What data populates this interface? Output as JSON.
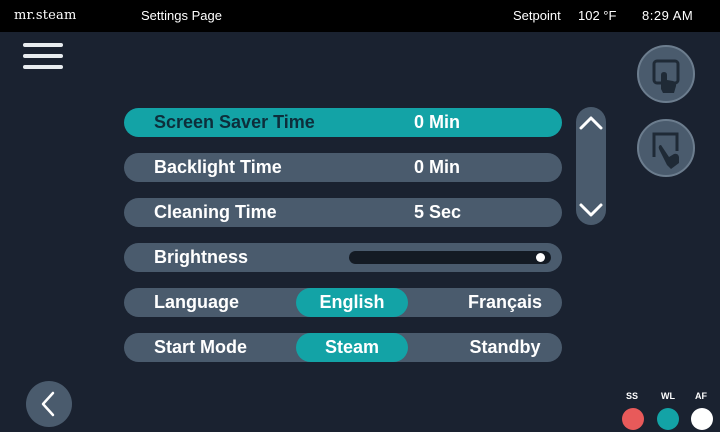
{
  "header": {
    "brand": "mr.steam",
    "title": "Settings Page",
    "setpoint_label": "Setpoint",
    "setpoint_value": "102 °F",
    "time": "8:29 AM"
  },
  "icons": {
    "menu": "hamburger-menu-icon",
    "touch_top": "hand-touch-up-icon",
    "touch_bottom": "hand-touch-down-icon",
    "scroll_up": "chevron-up-icon",
    "scroll_down": "chevron-down-icon",
    "back": "chevron-left-icon"
  },
  "settings": {
    "screen_saver": {
      "label": "Screen Saver Time",
      "value": "0 Min",
      "selected": true
    },
    "backlight": {
      "label": "Backlight Time",
      "value": "0 Min"
    },
    "cleaning": {
      "label": "Cleaning Time",
      "value": "5 Sec"
    },
    "brightness": {
      "label": "Brightness",
      "level": 1.0
    },
    "language": {
      "label": "Language",
      "options": [
        "English",
        "Français"
      ],
      "selected": "English"
    },
    "start_mode": {
      "label": "Start Mode",
      "options": [
        "Steam",
        "Standby"
      ],
      "selected": "Steam"
    }
  },
  "status": {
    "indicators": [
      {
        "label": "SS",
        "color": "#e85a5a"
      },
      {
        "label": "WL",
        "color": "#13a3a6"
      },
      {
        "label": "AF",
        "color": "#ffffff"
      }
    ]
  },
  "colors": {
    "accent": "#13a3a6",
    "row": "#4a5b6d",
    "background": "#1a2230",
    "header": "#000000"
  }
}
